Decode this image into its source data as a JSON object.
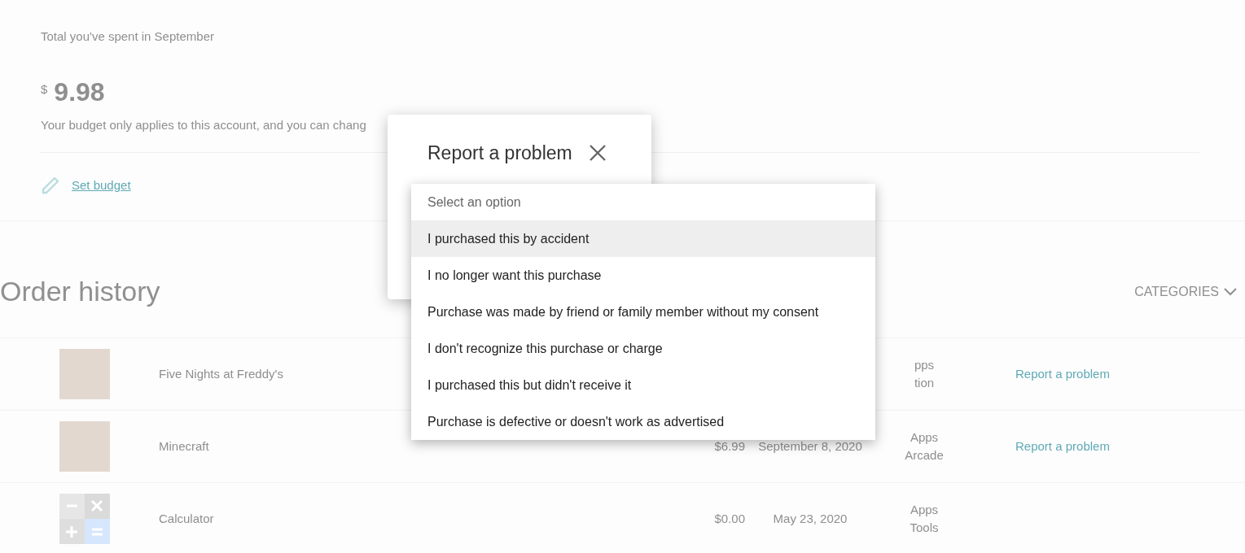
{
  "summary": {
    "label": "Total you've spent in September",
    "currency": "$",
    "amount": "9.98",
    "note": "Your budget only applies to this account, and you can chang",
    "set_budget": "Set budget"
  },
  "order_history": {
    "title": "Order history",
    "categories_button": "CATEGORIES",
    "rows": [
      {
        "kind": "photo",
        "name": "Five Nights at Freddy's",
        "category_lines": [
          "pps",
          "tion"
        ],
        "action": "Report a problem"
      },
      {
        "kind": "photo",
        "name": "Minecraft",
        "price": "$6.99",
        "date": "September 8, 2020",
        "category_lines": [
          "Apps",
          "Arcade"
        ],
        "action": "Report a problem"
      },
      {
        "kind": "calculator",
        "name": "Calculator",
        "price": "$0.00",
        "date": "May 23, 2020",
        "category_lines": [
          "Apps",
          "Tools"
        ]
      }
    ]
  },
  "dialog": {
    "title": "Report a problem",
    "select": {
      "placeholder": "Select an option",
      "options": [
        {
          "label": "I purchased this by accident",
          "selected": true
        },
        {
          "label": "I no longer want this purchase",
          "selected": false
        },
        {
          "label": "Purchase was made by friend or family member without my consent",
          "selected": false
        },
        {
          "label": "I don't recognize this purchase or charge",
          "selected": false
        },
        {
          "label": "I purchased this but didn't receive it",
          "selected": false
        },
        {
          "label": "Purchase is defective or doesn't work as advertised",
          "selected": false
        }
      ]
    }
  }
}
